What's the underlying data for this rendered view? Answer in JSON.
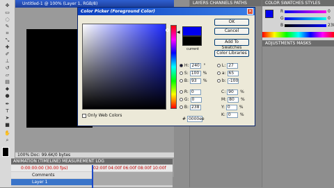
{
  "document": {
    "title": "Untitled-1 @ 100% (Layer 1, RGB/8)",
    "status": "100%   Doc: 99.6K/0 bytes"
  },
  "animation": {
    "tabs": "ANIMATION (TIMELINE)   MEASUREMENT LOG",
    "time": "0:00:00:00  (30.00 fps)",
    "ruler": "02:00f  04:00f  06:00f  08:00f  10:00f",
    "row1": "Comments",
    "row2": "Layer 1"
  },
  "panels": {
    "layers_tabs": "LAYERS  CHANNELS  PATHS",
    "color_tabs": "COLOR  SWATCHES  STYLES",
    "adj_tabs": "ADJUSTMENTS  MASKS",
    "color_labels": [
      "R",
      "G",
      "B"
    ],
    "color_values": [
      "0",
      "0",
      "238"
    ]
  },
  "dialog": {
    "title": "Color Picker (Foreground Color)",
    "close": "×",
    "current_label": "current",
    "buttons": {
      "ok": "OK",
      "cancel": "Cancel",
      "add_swatches": "Add To Swatches",
      "color_libraries": "Color Libraries"
    },
    "only_web": "Only Web Colors",
    "hex_label": "#",
    "hex_value": "0000ee",
    "hsb": [
      {
        "label": "H:",
        "value": "240",
        "unit": "°"
      },
      {
        "label": "S:",
        "value": "100",
        "unit": "%"
      },
      {
        "label": "B:",
        "value": "93",
        "unit": "%"
      }
    ],
    "rgb": [
      {
        "label": "R:",
        "value": "0"
      },
      {
        "label": "G:",
        "value": "0"
      },
      {
        "label": "B:",
        "value": "238"
      }
    ],
    "lab": [
      {
        "label": "L:",
        "value": "27"
      },
      {
        "label": "a:",
        "value": "65"
      },
      {
        "label": "b:",
        "value": "-100"
      }
    ],
    "cmyk": [
      {
        "label": "C:",
        "value": "90",
        "unit": "%"
      },
      {
        "label": "M:",
        "value": "80",
        "unit": "%"
      },
      {
        "label": "Y:",
        "value": "0",
        "unit": "%"
      },
      {
        "label": "K:",
        "value": "0",
        "unit": "%"
      }
    ]
  },
  "tools": [
    "move",
    "marquee",
    "lasso",
    "quick-select",
    "crop",
    "eyedropper",
    "healing",
    "brush",
    "stamp",
    "history-brush",
    "eraser",
    "gradient",
    "blur",
    "dodge",
    "pen",
    "type",
    "path-select",
    "shape",
    "hand",
    "zoom"
  ]
}
